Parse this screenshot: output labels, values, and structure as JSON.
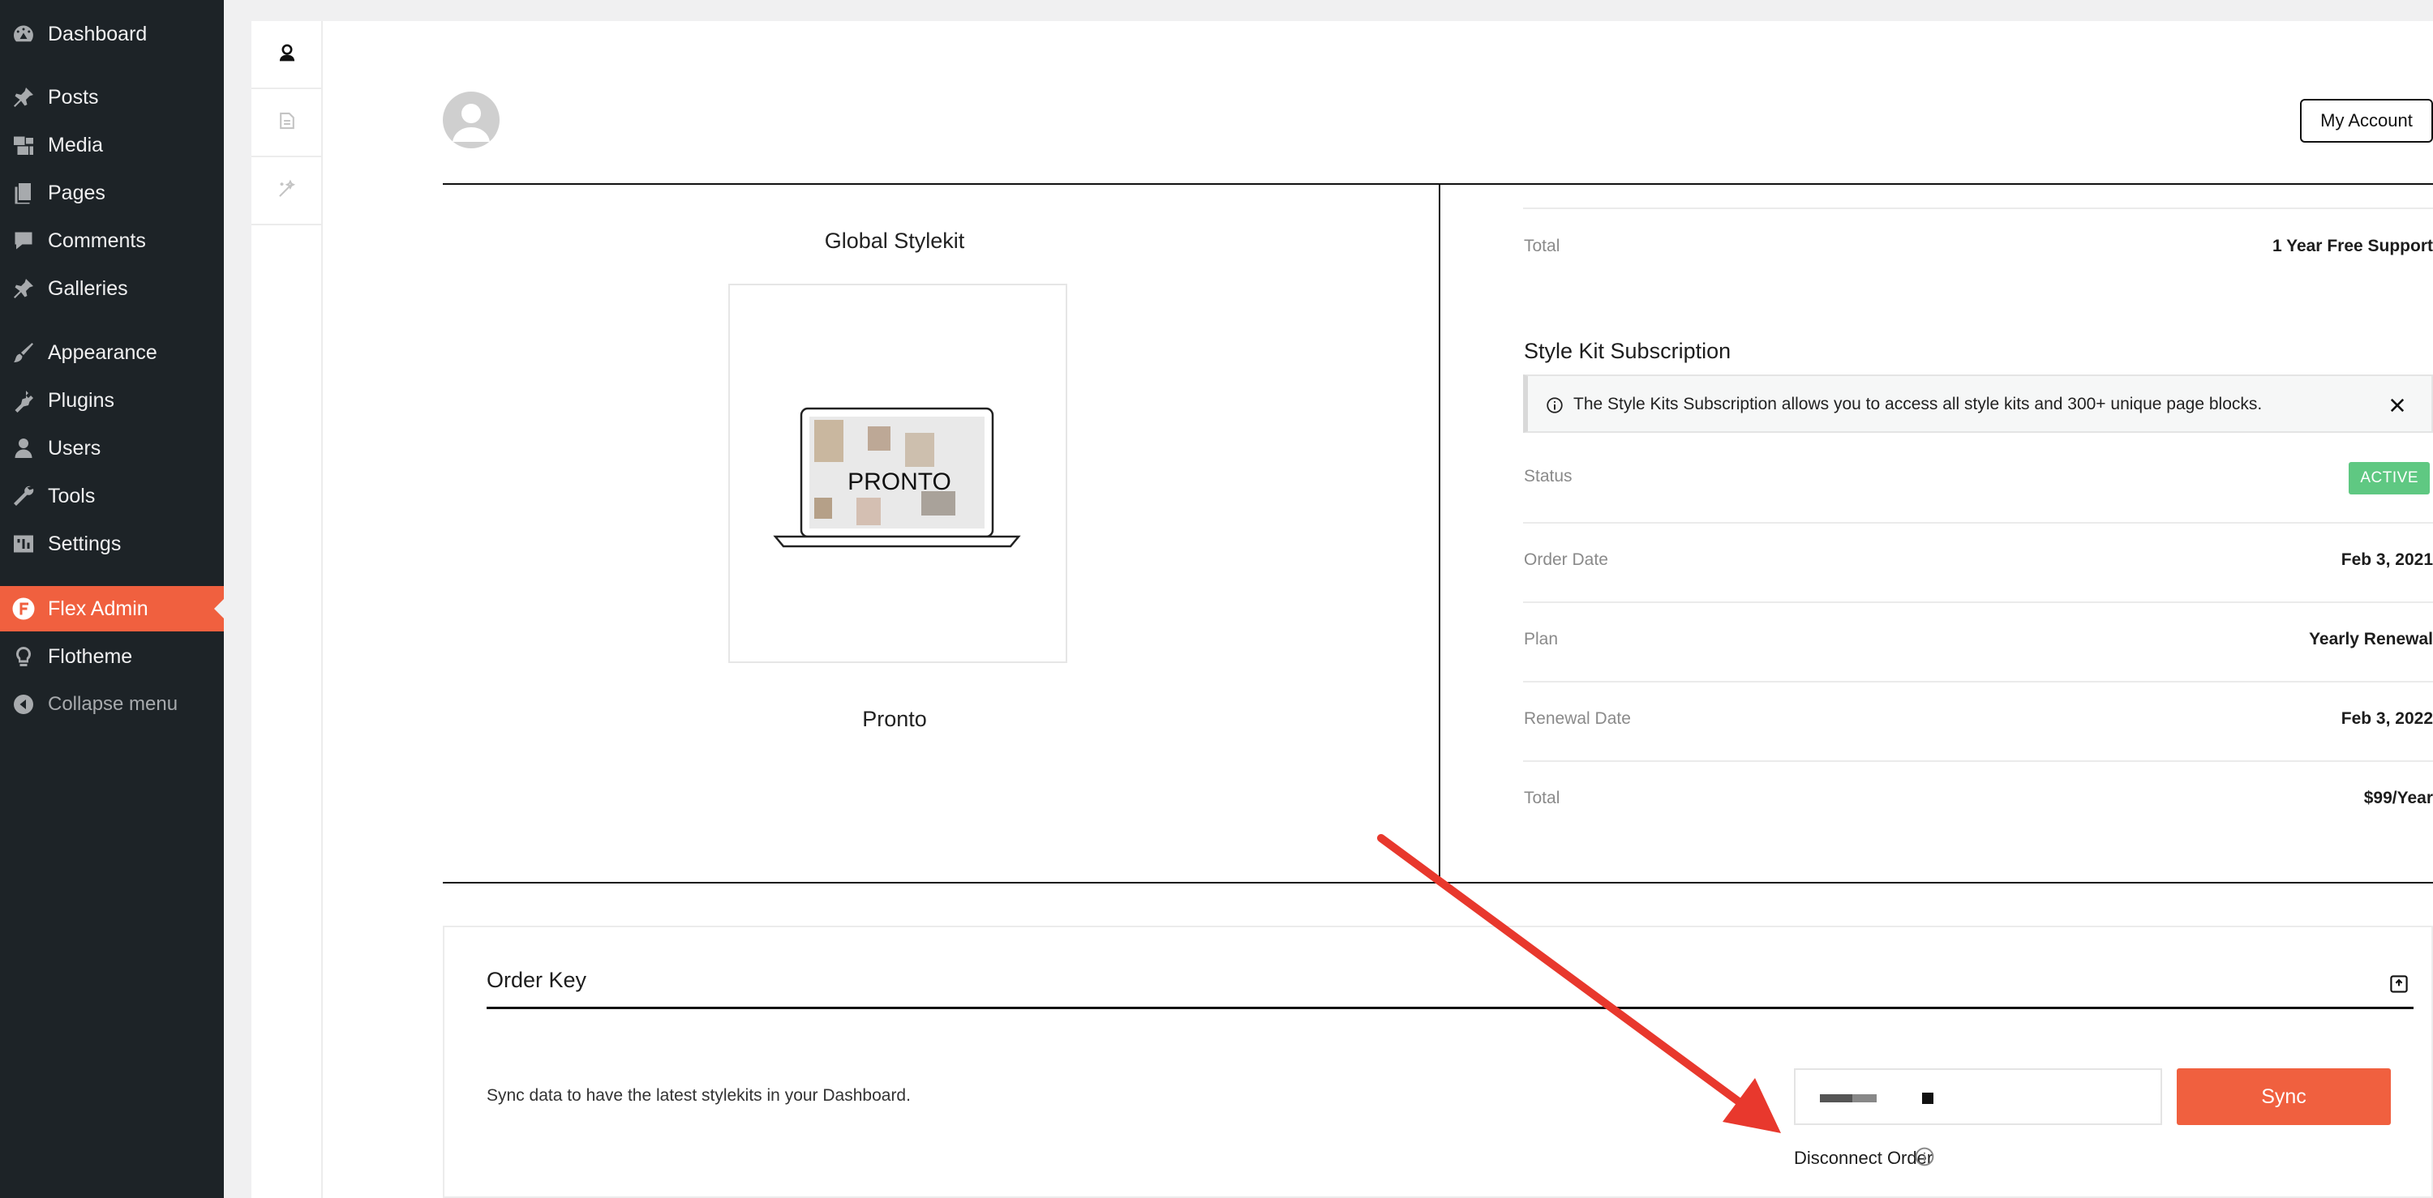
{
  "sidebar": {
    "items": [
      {
        "label": "Dashboard",
        "icon": "dashboard-icon"
      },
      {
        "label": "Posts",
        "icon": "pin-icon"
      },
      {
        "label": "Media",
        "icon": "media-icon"
      },
      {
        "label": "Pages",
        "icon": "pages-icon"
      },
      {
        "label": "Comments",
        "icon": "comment-icon"
      },
      {
        "label": "Galleries",
        "icon": "pin-icon"
      },
      {
        "label": "Appearance",
        "icon": "brush-icon"
      },
      {
        "label": "Plugins",
        "icon": "plug-icon"
      },
      {
        "label": "Users",
        "icon": "user-icon"
      },
      {
        "label": "Tools",
        "icon": "wrench-icon"
      },
      {
        "label": "Settings",
        "icon": "settings-icon"
      },
      {
        "label": "Flex Admin",
        "icon": "flex-logo-icon"
      },
      {
        "label": "Flotheme",
        "icon": "bulb-icon"
      },
      {
        "label": "Collapse menu",
        "icon": "collapse-icon"
      }
    ]
  },
  "header": {
    "account_button": "My Account"
  },
  "stylekit": {
    "heading": "Global Stylekit",
    "preview_text": "PRONTO",
    "name": "Pronto"
  },
  "account_info": {
    "top_total_label": "Total",
    "top_total_value": "1 Year Free Support",
    "subscription_title": "Style Kit Subscription",
    "notice": "The Style Kits Subscription allows you to access all style kits and 300+ unique page blocks.",
    "status_label": "Status",
    "status_value": "ACTIVE",
    "order_date_label": "Order Date",
    "order_date_value": "Feb 3, 2021",
    "plan_label": "Plan",
    "plan_value": "Yearly Renewal",
    "renewal_label": "Renewal Date",
    "renewal_value": "Feb 3, 2022",
    "total_label": "Total",
    "total_value": "$99/Year"
  },
  "order_key": {
    "title": "Order Key",
    "description": "Sync data to have the latest stylekits in your Dashboard.",
    "sync_button": "Sync",
    "disconnect_link": "Disconnect Order"
  },
  "colors": {
    "accent": "#f0603f",
    "sidebar_bg": "#1d2327",
    "active_badge": "#5fc882",
    "annotation_arrow": "#e8382d"
  }
}
